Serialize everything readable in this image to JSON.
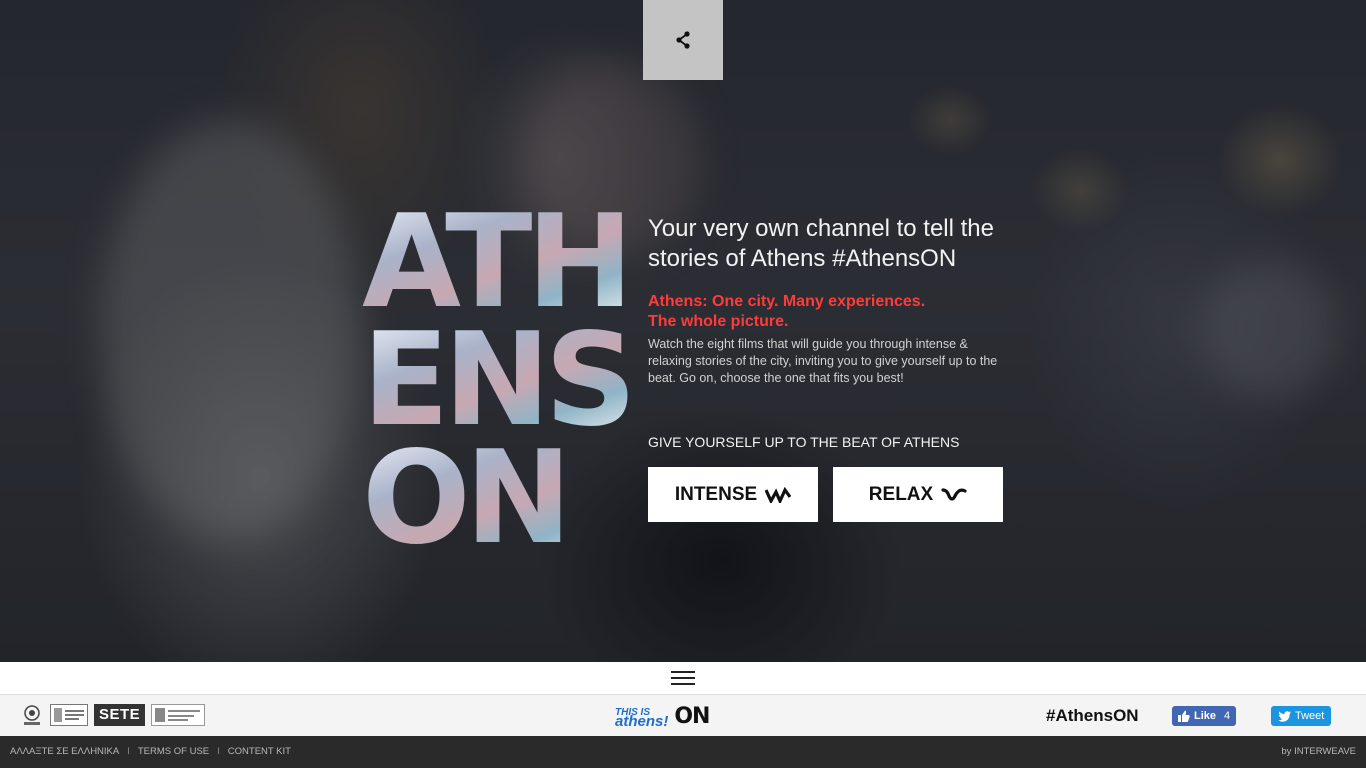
{
  "hero": {
    "headline": "Your very own channel to tell the stories of Athens #AthensON",
    "tagline_line1": "Athens: One city. Many experiences.",
    "tagline_line2": "The whole picture.",
    "description": "Watch the eight films that will guide you through intense & relaxing stories of the city, inviting you to give yourself up to the beat. Go on, choose the one that fits you best!",
    "beat_label": "GIVE YOURSELF UP TO THE BEAT OF ATHENS",
    "logo_lines": [
      "ATH",
      "ENS",
      "ON"
    ],
    "buttons": {
      "intense": "INTENSE",
      "relax": "RELAX"
    },
    "accent_color": "#ff3b3b"
  },
  "share": {
    "icon": "share-icon"
  },
  "menu": {
    "icon": "hamburger-icon"
  },
  "partners": {
    "items": [
      "city-of-athens-logo",
      "ministry-logo",
      "SETE",
      "partner-logo"
    ],
    "sete_label": "SETE"
  },
  "brand": {
    "this_is_small": "THIS IS",
    "this_is_big": "athens!",
    "on": "ON"
  },
  "social": {
    "hashtag": "#AthensON",
    "like_label": "Like",
    "like_count": "4",
    "tweet_label": "Tweet"
  },
  "footer": {
    "links": [
      "ΑΛΛΑΞΤΕ ΣΕ ΕΛΛΗΝΙΚΑ",
      "TERMS OF USE",
      "CONTENT KIT"
    ],
    "credit": "by INTERWEAVE"
  }
}
